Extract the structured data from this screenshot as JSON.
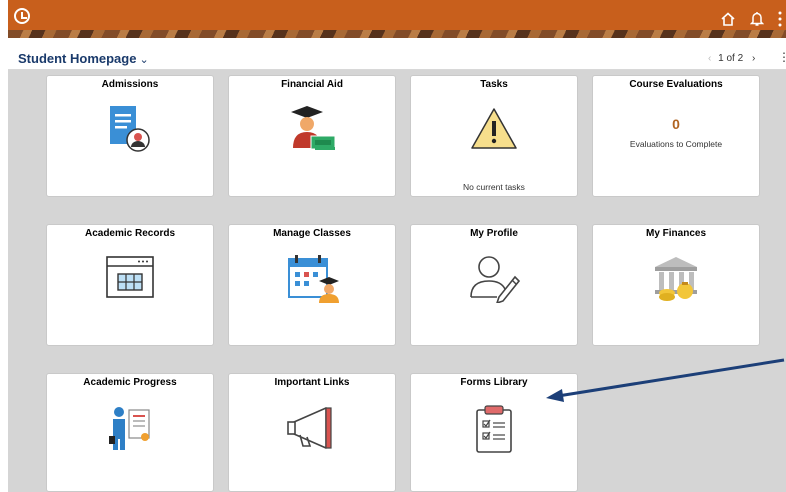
{
  "header": {
    "title": "Student Homepage",
    "pager": "1 of 2"
  },
  "tiles": [
    {
      "label": "Admissions"
    },
    {
      "label": "Financial Aid"
    },
    {
      "label": "Tasks",
      "footer": "No current tasks"
    },
    {
      "label": "Course Evaluations",
      "count": "0",
      "footer": "Evaluations to Complete"
    },
    {
      "label": "Academic Records"
    },
    {
      "label": "Manage Classes"
    },
    {
      "label": "My Profile"
    },
    {
      "label": "My Finances"
    },
    {
      "label": "Academic Progress"
    },
    {
      "label": "Important Links"
    },
    {
      "label": "Forms Library"
    }
  ],
  "colors": {
    "banner": "#c85f1c",
    "title": "#1a3a6b",
    "background": "#d5d5d5",
    "accent_blue": "#3a8fd6",
    "annotation_arrow": "#1c3f78"
  },
  "icons": [
    "history-icon",
    "home-icon",
    "notification-bell-icon",
    "more-options-icon"
  ]
}
